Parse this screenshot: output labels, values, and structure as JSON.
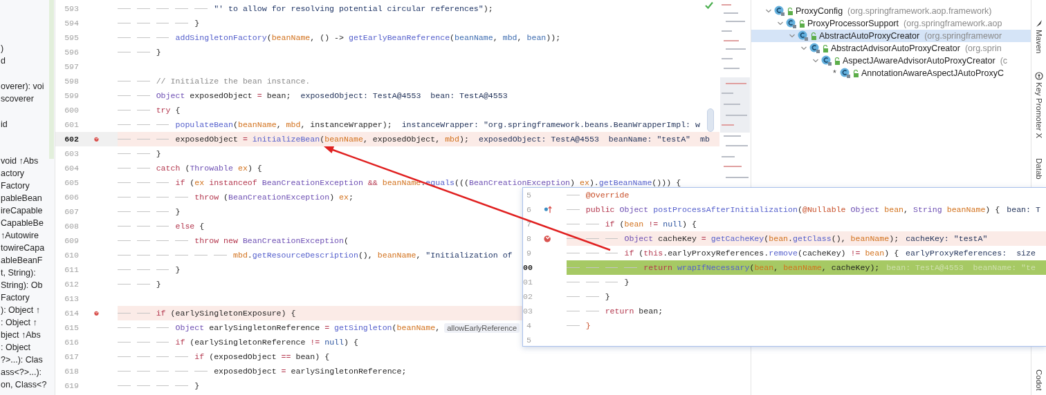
{
  "structure_panel": {
    "groups": [
      {
        "items": [
          ")",
          "d"
        ]
      },
      {
        "items": [
          "overer): voi",
          "scoverer"
        ]
      },
      {
        "items": [
          "id"
        ]
      },
      {
        "items": [
          "void ↑Abs",
          "actory",
          "Factory",
          "pableBean",
          "ireCapable",
          "CapableBe",
          "↑Autowire",
          "towireCapa",
          "ableBeanF",
          "t, String): ",
          "String): Ob",
          "Factory",
          "): Object ↑",
          ": Object ↑",
          "bject ↑Abs",
          ": Object",
          "?>...): Clas",
          "ass<?>...):",
          "on, Class<?"
        ]
      }
    ]
  },
  "editor": {
    "lines": [
      {
        "number": "593",
        "breakpoint": false,
        "current": false,
        "code": [
          {
            "kind": "str",
            "text": "                    \"' to allow for resolving potential circular references\""
          },
          {
            "kind": "t",
            "text": ");"
          }
        ]
      },
      {
        "number": "594",
        "breakpoint": false,
        "current": false,
        "code": [
          {
            "kind": "t",
            "text": "                }"
          }
        ]
      },
      {
        "number": "595",
        "breakpoint": false,
        "current": false,
        "code": [
          {
            "kind": "fn",
            "text": "            addSingletonFactory"
          },
          {
            "kind": "t",
            "text": "("
          },
          {
            "kind": "param",
            "text": "beanName"
          },
          {
            "kind": "t",
            "text": ", () -> "
          },
          {
            "kind": "fn",
            "text": "getEarlyBeanReference"
          },
          {
            "kind": "t",
            "text": "("
          },
          {
            "kind": "cap",
            "text": "beanName"
          },
          {
            "kind": "t",
            "text": ", "
          },
          {
            "kind": "cap",
            "text": "mbd"
          },
          {
            "kind": "t",
            "text": ", "
          },
          {
            "kind": "cap",
            "text": "bean"
          },
          {
            "kind": "t",
            "text": "));"
          }
        ]
      },
      {
        "number": "596",
        "breakpoint": false,
        "current": false,
        "code": [
          {
            "kind": "t",
            "text": "        }"
          }
        ]
      },
      {
        "number": "597",
        "breakpoint": false,
        "current": false
      },
      {
        "number": "598",
        "breakpoint": false,
        "current": false,
        "code": [
          {
            "kind": "cm",
            "text": "        // Initialize the bean instance."
          }
        ]
      },
      {
        "number": "599",
        "breakpoint": false,
        "current": false,
        "code": [
          {
            "kind": "type",
            "text": "        Object"
          },
          {
            "kind": "t",
            "text": " exposedObject "
          },
          {
            "kind": "op",
            "text": "="
          },
          {
            "kind": "t",
            "text": " bean;"
          }
        ],
        "hints": [
          {
            "kind": "value",
            "text": "exposedObject: TestA@4553  bean: TestA@4553"
          }
        ]
      },
      {
        "number": "600",
        "breakpoint": false,
        "current": false,
        "code": [
          {
            "kind": "kw",
            "text": "        try"
          },
          {
            "kind": "t",
            "text": " {"
          }
        ]
      },
      {
        "number": "601",
        "breakpoint": false,
        "current": false,
        "code": [
          {
            "kind": "fn",
            "text": "            populateBean"
          },
          {
            "kind": "t",
            "text": "("
          },
          {
            "kind": "param",
            "text": "beanName"
          },
          {
            "kind": "t",
            "text": ", "
          },
          {
            "kind": "param",
            "text": "mbd"
          },
          {
            "kind": "t",
            "text": ", instanceWrapper);"
          }
        ],
        "hints": [
          {
            "kind": "value",
            "text": "instanceWrapper: \"org.springframework.beans.BeanWrapperImpl: w"
          }
        ]
      },
      {
        "number": "602",
        "breakpoint": true,
        "current": true,
        "code": [
          {
            "kind": "t",
            "text": "            exposedObject "
          },
          {
            "kind": "op",
            "text": "= "
          },
          {
            "kind": "fn",
            "text": "initializeBean"
          },
          {
            "kind": "t",
            "text": "("
          },
          {
            "kind": "param",
            "text": "beanName"
          },
          {
            "kind": "t",
            "text": ", exposedObject, "
          },
          {
            "kind": "param",
            "text": "mbd"
          },
          {
            "kind": "t",
            "text": ");"
          }
        ],
        "hints": [
          {
            "kind": "value",
            "text": "exposedObject: TestA@4553  beanName: \"testA\"  mb"
          }
        ]
      },
      {
        "number": "603",
        "breakpoint": false,
        "current": false,
        "code": [
          {
            "kind": "t",
            "text": "        }"
          }
        ]
      },
      {
        "number": "604",
        "breakpoint": false,
        "current": false,
        "code": [
          {
            "kind": "kw",
            "text": "        catch"
          },
          {
            "kind": "t",
            "text": " ("
          },
          {
            "kind": "type",
            "text": "Throwable "
          },
          {
            "kind": "param",
            "text": "ex"
          },
          {
            "kind": "t",
            "text": ") {"
          }
        ]
      },
      {
        "number": "605",
        "breakpoint": false,
        "current": false,
        "code": [
          {
            "kind": "kw",
            "text": "            if"
          },
          {
            "kind": "t",
            "text": " ("
          },
          {
            "kind": "param",
            "text": "ex "
          },
          {
            "kind": "kw",
            "text": "instanceof "
          },
          {
            "kind": "type",
            "text": "BeanCreationException "
          },
          {
            "kind": "op",
            "text": "&& "
          },
          {
            "kind": "param",
            "text": "beanName"
          },
          {
            "kind": "t",
            "text": "."
          },
          {
            "kind": "fn",
            "text": "equals"
          },
          {
            "kind": "t",
            "text": "((("
          },
          {
            "kind": "type",
            "text": "BeanCreationException"
          },
          {
            "kind": "t",
            "text": ") "
          },
          {
            "kind": "param",
            "text": "ex"
          },
          {
            "kind": "t",
            "text": ")."
          },
          {
            "kind": "fn",
            "text": "getBeanName"
          },
          {
            "kind": "t",
            "text": "())) {"
          }
        ]
      },
      {
        "number": "606",
        "breakpoint": false,
        "current": false,
        "code": [
          {
            "kind": "kw",
            "text": "                throw"
          },
          {
            "kind": "t",
            "text": " ("
          },
          {
            "kind": "type",
            "text": "BeanCreationException"
          },
          {
            "kind": "t",
            "text": ") "
          },
          {
            "kind": "param",
            "text": "ex"
          },
          {
            "kind": "t",
            "text": ";"
          }
        ]
      },
      {
        "number": "607",
        "breakpoint": false,
        "current": false,
        "code": [
          {
            "kind": "t",
            "text": "            }"
          }
        ]
      },
      {
        "number": "608",
        "breakpoint": false,
        "current": false,
        "code": [
          {
            "kind": "kw",
            "text": "            else"
          },
          {
            "kind": "t",
            "text": " {"
          }
        ]
      },
      {
        "number": "609",
        "breakpoint": false,
        "current": false,
        "code": [
          {
            "kind": "kw",
            "text": "                throw new "
          },
          {
            "kind": "type",
            "text": "BeanCreationException"
          },
          {
            "kind": "t",
            "text": "("
          }
        ]
      },
      {
        "number": "610",
        "breakpoint": false,
        "current": false,
        "code": [
          {
            "kind": "param",
            "text": "                        mbd"
          },
          {
            "kind": "t",
            "text": "."
          },
          {
            "kind": "fn",
            "text": "getResourceDescription"
          },
          {
            "kind": "t",
            "text": "(), "
          },
          {
            "kind": "param",
            "text": "beanName"
          },
          {
            "kind": "t",
            "text": ", "
          },
          {
            "kind": "str",
            "text": "\"Initialization of"
          }
        ]
      },
      {
        "number": "611",
        "breakpoint": false,
        "current": false,
        "code": [
          {
            "kind": "t",
            "text": "            }"
          }
        ]
      },
      {
        "number": "612",
        "breakpoint": false,
        "current": false,
        "code": [
          {
            "kind": "t",
            "text": "        }"
          }
        ]
      },
      {
        "number": "613",
        "breakpoint": false,
        "current": false
      },
      {
        "number": "614",
        "breakpoint": true,
        "current": false,
        "code": [
          {
            "kind": "kw",
            "text": "        if"
          },
          {
            "kind": "t",
            "text": " (earlySingletonExposure) {"
          }
        ]
      },
      {
        "number": "615",
        "breakpoint": false,
        "current": false,
        "code": [
          {
            "kind": "type",
            "text": "            Object"
          },
          {
            "kind": "t",
            "text": " earlySingletonReference "
          },
          {
            "kind": "op",
            "text": "= "
          },
          {
            "kind": "fn",
            "text": "getSingleton"
          },
          {
            "kind": "t",
            "text": "("
          },
          {
            "kind": "param",
            "text": "beanName"
          },
          {
            "kind": "t",
            "text": ","
          }
        ],
        "hints": [
          {
            "kind": "param",
            "text": "allowEarlyReference"
          }
        ]
      },
      {
        "number": "616",
        "breakpoint": false,
        "current": false,
        "code": [
          {
            "kind": "kw",
            "text": "            if"
          },
          {
            "kind": "t",
            "text": " (earlySingletonReference "
          },
          {
            "kind": "op",
            "text": "!= "
          },
          {
            "kind": "lit",
            "text": "null"
          },
          {
            "kind": "t",
            "text": ") {"
          }
        ]
      },
      {
        "number": "617",
        "breakpoint": false,
        "current": false,
        "code": [
          {
            "kind": "kw",
            "text": "                if"
          },
          {
            "kind": "t",
            "text": " (exposedObject "
          },
          {
            "kind": "op",
            "text": "=="
          },
          {
            "kind": "t",
            "text": " bean) {"
          }
        ]
      },
      {
        "number": "618",
        "breakpoint": false,
        "current": false,
        "code": [
          {
            "kind": "t",
            "text": "                    exposedObject "
          },
          {
            "kind": "op",
            "text": "="
          },
          {
            "kind": "t",
            "text": " earlySingletonReference;"
          }
        ]
      },
      {
        "number": "619",
        "breakpoint": false,
        "current": false,
        "code": [
          {
            "kind": "t",
            "text": "                }"
          }
        ]
      }
    ]
  },
  "popup": {
    "lines": [
      {
        "number": "5",
        "breakpoint": false,
        "current": false,
        "override": false,
        "code": [
          {
            "kind": "ann",
            "text": "    @Override"
          }
        ]
      },
      {
        "number": "6",
        "breakpoint": false,
        "current": false,
        "override": true,
        "code": [
          {
            "kind": "kw",
            "text": "    public "
          },
          {
            "kind": "type",
            "text": "Object "
          },
          {
            "kind": "fn",
            "text": "postProcessAfterInitialization"
          },
          {
            "kind": "t",
            "text": "("
          },
          {
            "kind": "ann",
            "text": "@Nullable "
          },
          {
            "kind": "type",
            "text": "Object "
          },
          {
            "kind": "param",
            "text": "bean"
          },
          {
            "kind": "t",
            "text": ", "
          },
          {
            "kind": "type",
            "text": "String "
          },
          {
            "kind": "param",
            "text": "beanName"
          },
          {
            "kind": "t",
            "text": ") {"
          }
        ],
        "hints": [
          {
            "kind": "value",
            "text": "bean: T"
          }
        ]
      },
      {
        "number": "7",
        "breakpoint": false,
        "current": false,
        "override": false,
        "code": [
          {
            "kind": "kw",
            "text": "        if"
          },
          {
            "kind": "t",
            "text": " ("
          },
          {
            "kind": "param",
            "text": "bean "
          },
          {
            "kind": "op",
            "text": "!= "
          },
          {
            "kind": "lit",
            "text": "null"
          },
          {
            "kind": "t",
            "text": ") {"
          }
        ]
      },
      {
        "number": "8",
        "breakpoint": true,
        "current": false,
        "override": false,
        "code": [
          {
            "kind": "type",
            "text": "            Object"
          },
          {
            "kind": "t",
            "text": " cacheKey "
          },
          {
            "kind": "op",
            "text": "= "
          },
          {
            "kind": "fn",
            "text": "getCacheKey"
          },
          {
            "kind": "t",
            "text": "("
          },
          {
            "kind": "param",
            "text": "bean"
          },
          {
            "kind": "t",
            "text": "."
          },
          {
            "kind": "fn",
            "text": "getClass"
          },
          {
            "kind": "t",
            "text": "(), "
          },
          {
            "kind": "param",
            "text": "beanName"
          },
          {
            "kind": "t",
            "text": ");"
          }
        ],
        "hints": [
          {
            "kind": "value",
            "text": "cacheKey: \"testA\""
          }
        ]
      },
      {
        "number": "9",
        "breakpoint": false,
        "current": false,
        "override": false,
        "code": [
          {
            "kind": "kw",
            "text": "            if"
          },
          {
            "kind": "t",
            "text": " ("
          },
          {
            "kind": "kw",
            "text": "this"
          },
          {
            "kind": "t",
            "text": ".earlyProxyReferences."
          },
          {
            "kind": "fn",
            "text": "remove"
          },
          {
            "kind": "t",
            "text": "(cacheKey) "
          },
          {
            "kind": "op",
            "text": "!= "
          },
          {
            "kind": "param",
            "text": "bean"
          },
          {
            "kind": "t",
            "text": ") {"
          }
        ],
        "hints": [
          {
            "kind": "value",
            "text": "earlyProxyReferences:  size"
          }
        ]
      },
      {
        "number": "00",
        "breakpoint": false,
        "current": true,
        "override": false,
        "code": [
          {
            "kind": "kw",
            "text": "                return "
          },
          {
            "kind": "fn",
            "text": "wrapIfNecessary"
          },
          {
            "kind": "t",
            "text": "("
          },
          {
            "kind": "param",
            "text": "bean"
          },
          {
            "kind": "t",
            "text": ", "
          },
          {
            "kind": "param",
            "text": "beanName"
          },
          {
            "kind": "t",
            "text": ", cacheKey);"
          }
        ],
        "hints": [
          {
            "kind": "faded",
            "text": "bean: TestA@4553  beanName: \"te"
          }
        ]
      },
      {
        "number": "01",
        "breakpoint": false,
        "current": false,
        "override": false,
        "code": [
          {
            "kind": "t",
            "text": "            }"
          }
        ]
      },
      {
        "number": "02",
        "breakpoint": false,
        "current": false,
        "override": false,
        "code": [
          {
            "kind": "t",
            "text": "        }"
          }
        ]
      },
      {
        "number": "03",
        "breakpoint": false,
        "current": false,
        "override": false,
        "code": [
          {
            "kind": "kw",
            "text": "        return"
          },
          {
            "kind": "t",
            "text": " bean;"
          }
        ]
      },
      {
        "number": "4",
        "breakpoint": false,
        "current": false,
        "override": false,
        "code": [
          {
            "kind": "ann",
            "text": "    }"
          }
        ]
      },
      {
        "number": "5",
        "breakpoint": false,
        "current": false,
        "override": false
      }
    ]
  },
  "hierarchy": {
    "items": [
      {
        "name": "ProxyConfig",
        "package": "(org.springframework.aop.framework)",
        "selected": false,
        "expanded": true,
        "children": [
          {
            "name": "ProxyProcessorSupport",
            "package": "(org.springframework.aop",
            "selected": false,
            "expanded": true,
            "children": [
              {
                "name": "AbstractAutoProxyCreator",
                "package": "(org.springframewor",
                "selected": true,
                "expanded": true,
                "children": [
                  {
                    "name": "AbstractAdvisorAutoProxyCreator",
                    "package": "(org.sprin",
                    "selected": false,
                    "expanded": true,
                    "children": [
                      {
                        "name": "AspectJAwareAdvisorAutoProxyCreator",
                        "package": "(c",
                        "selected": false,
                        "expanded": true,
                        "children": [
                          {
                            "name": "AnnotationAwareAspectJAutoProxyC",
                            "marker": "*",
                            "selected": false
                          }
                        ]
                      }
                    ]
                  }
                ]
              }
            ]
          }
        ]
      }
    ]
  },
  "tool_stripe": {
    "tabs": [
      {
        "label": "Maven"
      },
      {
        "label": "Key Promoter X"
      },
      {
        "label": "Datab"
      },
      {
        "label": "Codot"
      }
    ]
  }
}
